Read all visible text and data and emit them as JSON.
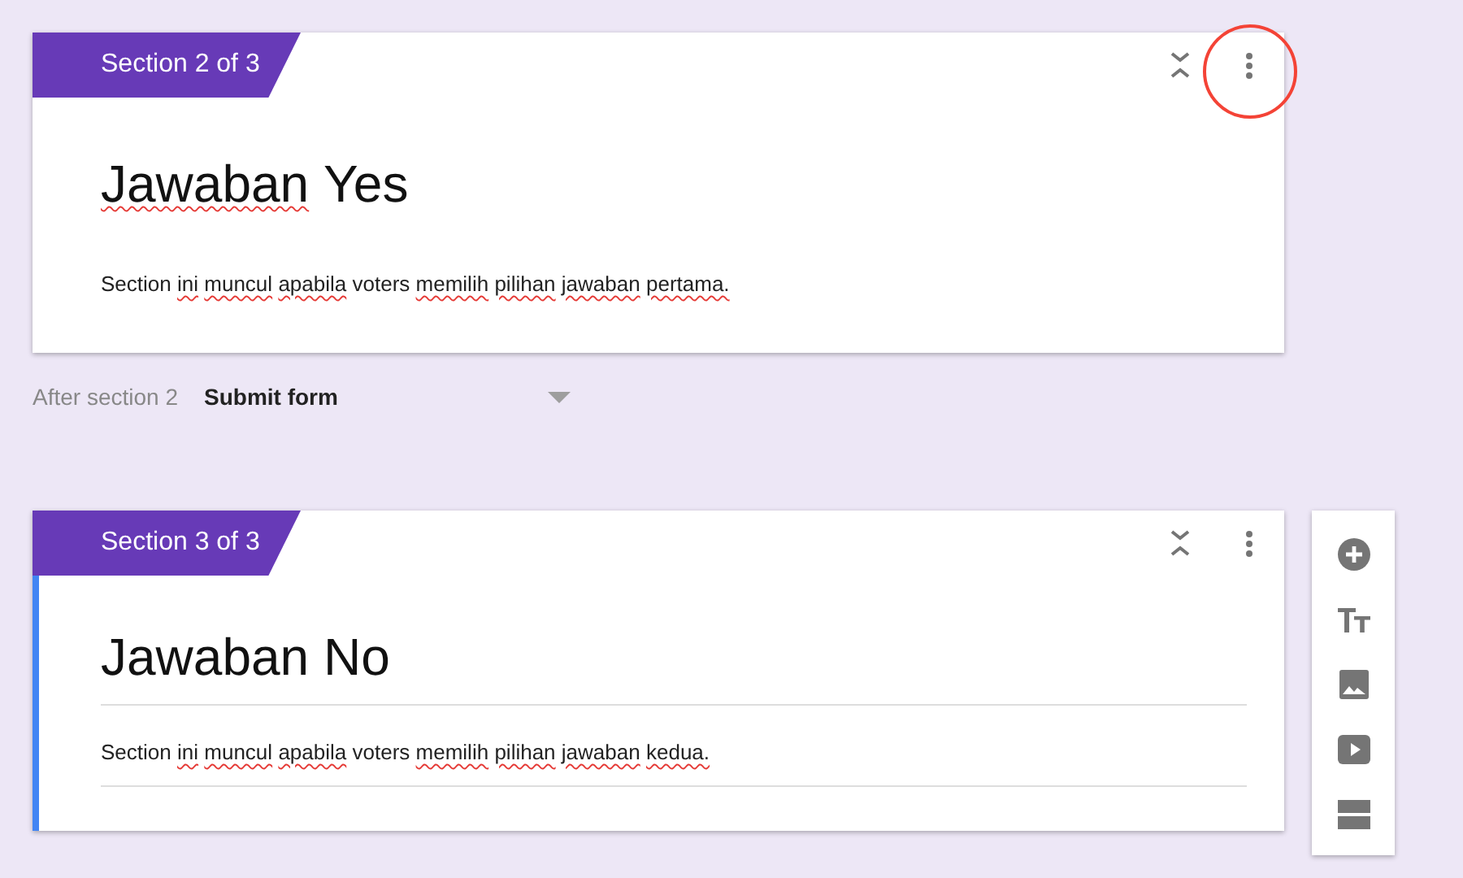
{
  "sections": [
    {
      "badge": "Section 2 of 3",
      "selected": false,
      "menu_highlighted": true,
      "title": [
        {
          "text": "Jawaban",
          "misspelled": true
        },
        {
          "text": "Yes",
          "misspelled": false
        }
      ],
      "description": [
        {
          "text": "Section",
          "misspelled": false
        },
        {
          "text": "ini",
          "misspelled": true
        },
        {
          "text": "muncul",
          "misspelled": true
        },
        {
          "text": "apabila",
          "misspelled": true
        },
        {
          "text": "voters",
          "misspelled": false
        },
        {
          "text": "memilih",
          "misspelled": true
        },
        {
          "text": "pilihan",
          "misspelled": true
        },
        {
          "text": "jawaban",
          "misspelled": true
        },
        {
          "text": "pertama.",
          "misspelled": true
        }
      ],
      "after": {
        "label": "After section 2",
        "value": "Submit form"
      }
    },
    {
      "badge": "Section 3 of 3",
      "selected": true,
      "menu_highlighted": false,
      "title": [
        {
          "text": "Jawaban",
          "misspelled": false
        },
        {
          "text": "No",
          "misspelled": false
        }
      ],
      "description": [
        {
          "text": "Section",
          "misspelled": false
        },
        {
          "text": "ini",
          "misspelled": true
        },
        {
          "text": "muncul",
          "misspelled": true
        },
        {
          "text": "apabila",
          "misspelled": true
        },
        {
          "text": "voters",
          "misspelled": false
        },
        {
          "text": "memilih",
          "misspelled": true
        },
        {
          "text": "pilihan",
          "misspelled": true
        },
        {
          "text": "jawaban",
          "misspelled": true
        },
        {
          "text": "kedua.",
          "misspelled": true
        }
      ]
    }
  ],
  "toolbar": [
    {
      "kind": "add"
    },
    {
      "kind": "title"
    },
    {
      "kind": "image"
    },
    {
      "kind": "video"
    },
    {
      "kind": "section"
    }
  ]
}
